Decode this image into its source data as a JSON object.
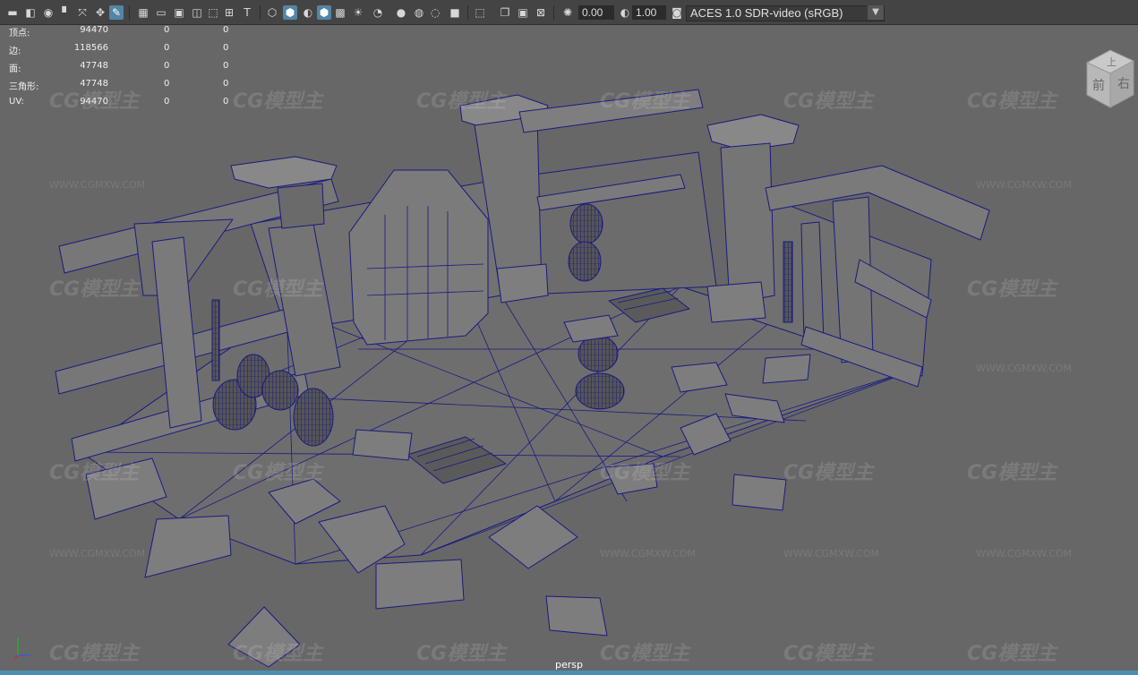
{
  "toolbar": {
    "exposure_value": "0.00",
    "gamma_value": "1.00",
    "color_space": "ACES 1.0 SDR-video (sRGB)"
  },
  "hud": {
    "rows": [
      {
        "label": "顶点:",
        "v1": "94470",
        "v2": "0",
        "v3": "0"
      },
      {
        "label": "边:",
        "v1": "118566",
        "v2": "0",
        "v3": "0"
      },
      {
        "label": "面:",
        "v1": "47748",
        "v2": "0",
        "v3": "0"
      },
      {
        "label": "三角形:",
        "v1": "47748",
        "v2": "0",
        "v3": "0"
      },
      {
        "label": "UV:",
        "v1": "94470",
        "v2": "0",
        "v3": "0"
      }
    ]
  },
  "viewcube": {
    "top": "上",
    "front": "前",
    "right": "右"
  },
  "camera": "persp",
  "watermark": {
    "logo": "CG模型主",
    "url": "WWW.CGMXW.COM"
  },
  "colors": {
    "wire": "#1a1a80",
    "viewport_bg": "#676767",
    "accent": "#5285a6"
  },
  "icons": [
    "camera-icon",
    "film-icon",
    "grid-icon",
    "shaded-icon",
    "wireframe-icon",
    "lighting-icon",
    "xray-icon",
    "exposure-icon",
    "gamma-icon"
  ]
}
